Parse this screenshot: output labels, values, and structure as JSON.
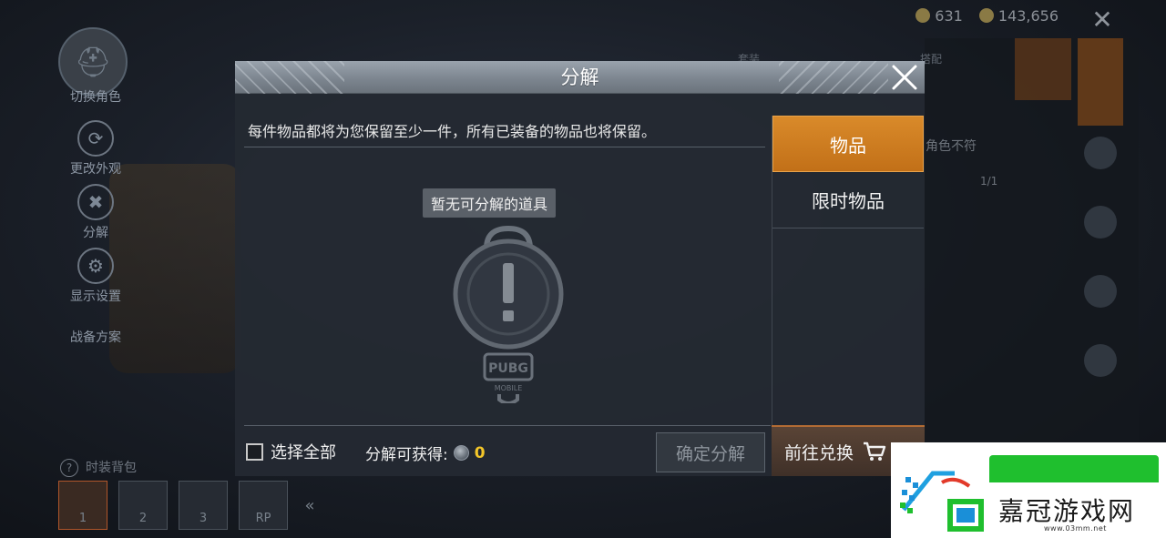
{
  "background": {
    "currency": {
      "coupons": "631",
      "bp": "143,656"
    },
    "left_menu": [
      {
        "label": "切换角色",
        "icon": "helmet-icon"
      },
      {
        "label": "更改外观",
        "icon": "refresh-icon"
      },
      {
        "label": "分解",
        "icon": "decompose-icon"
      },
      {
        "label": "显示设置",
        "icon": "gear-icon"
      },
      {
        "label": "战备方案",
        "icon": "crate-icon"
      }
    ],
    "right_panel": {
      "tab_1": "套装",
      "tab_2": "搭配",
      "note": "角色不符",
      "count": "1/1"
    },
    "backpack_label": "时装背包",
    "slots": [
      "1",
      "2",
      "3",
      "RP"
    ]
  },
  "modal": {
    "title": "分解",
    "notice": "每件物品都将为您保留至少一件，所有已装备的物品也将保留。",
    "empty_text": "暂无可分解的道具",
    "emblem_text": "PUBG",
    "emblem_subtext": "MOBILE",
    "tabs": [
      {
        "label": "物品",
        "active": true
      },
      {
        "label": "限时物品",
        "active": false
      }
    ],
    "select_all_label": "选择全部",
    "gain_label": "分解可获得:",
    "gain_value": "0",
    "confirm_label": "确定分解",
    "redeem_label": "前往兑换"
  },
  "watermark": {
    "text": "嘉冠游戏网",
    "url": "www.03mm.net"
  },
  "colors": {
    "accent_orange": "#d98a2a",
    "gain_yellow": "#f3c629",
    "watermark_green": "#1fbf2e"
  }
}
